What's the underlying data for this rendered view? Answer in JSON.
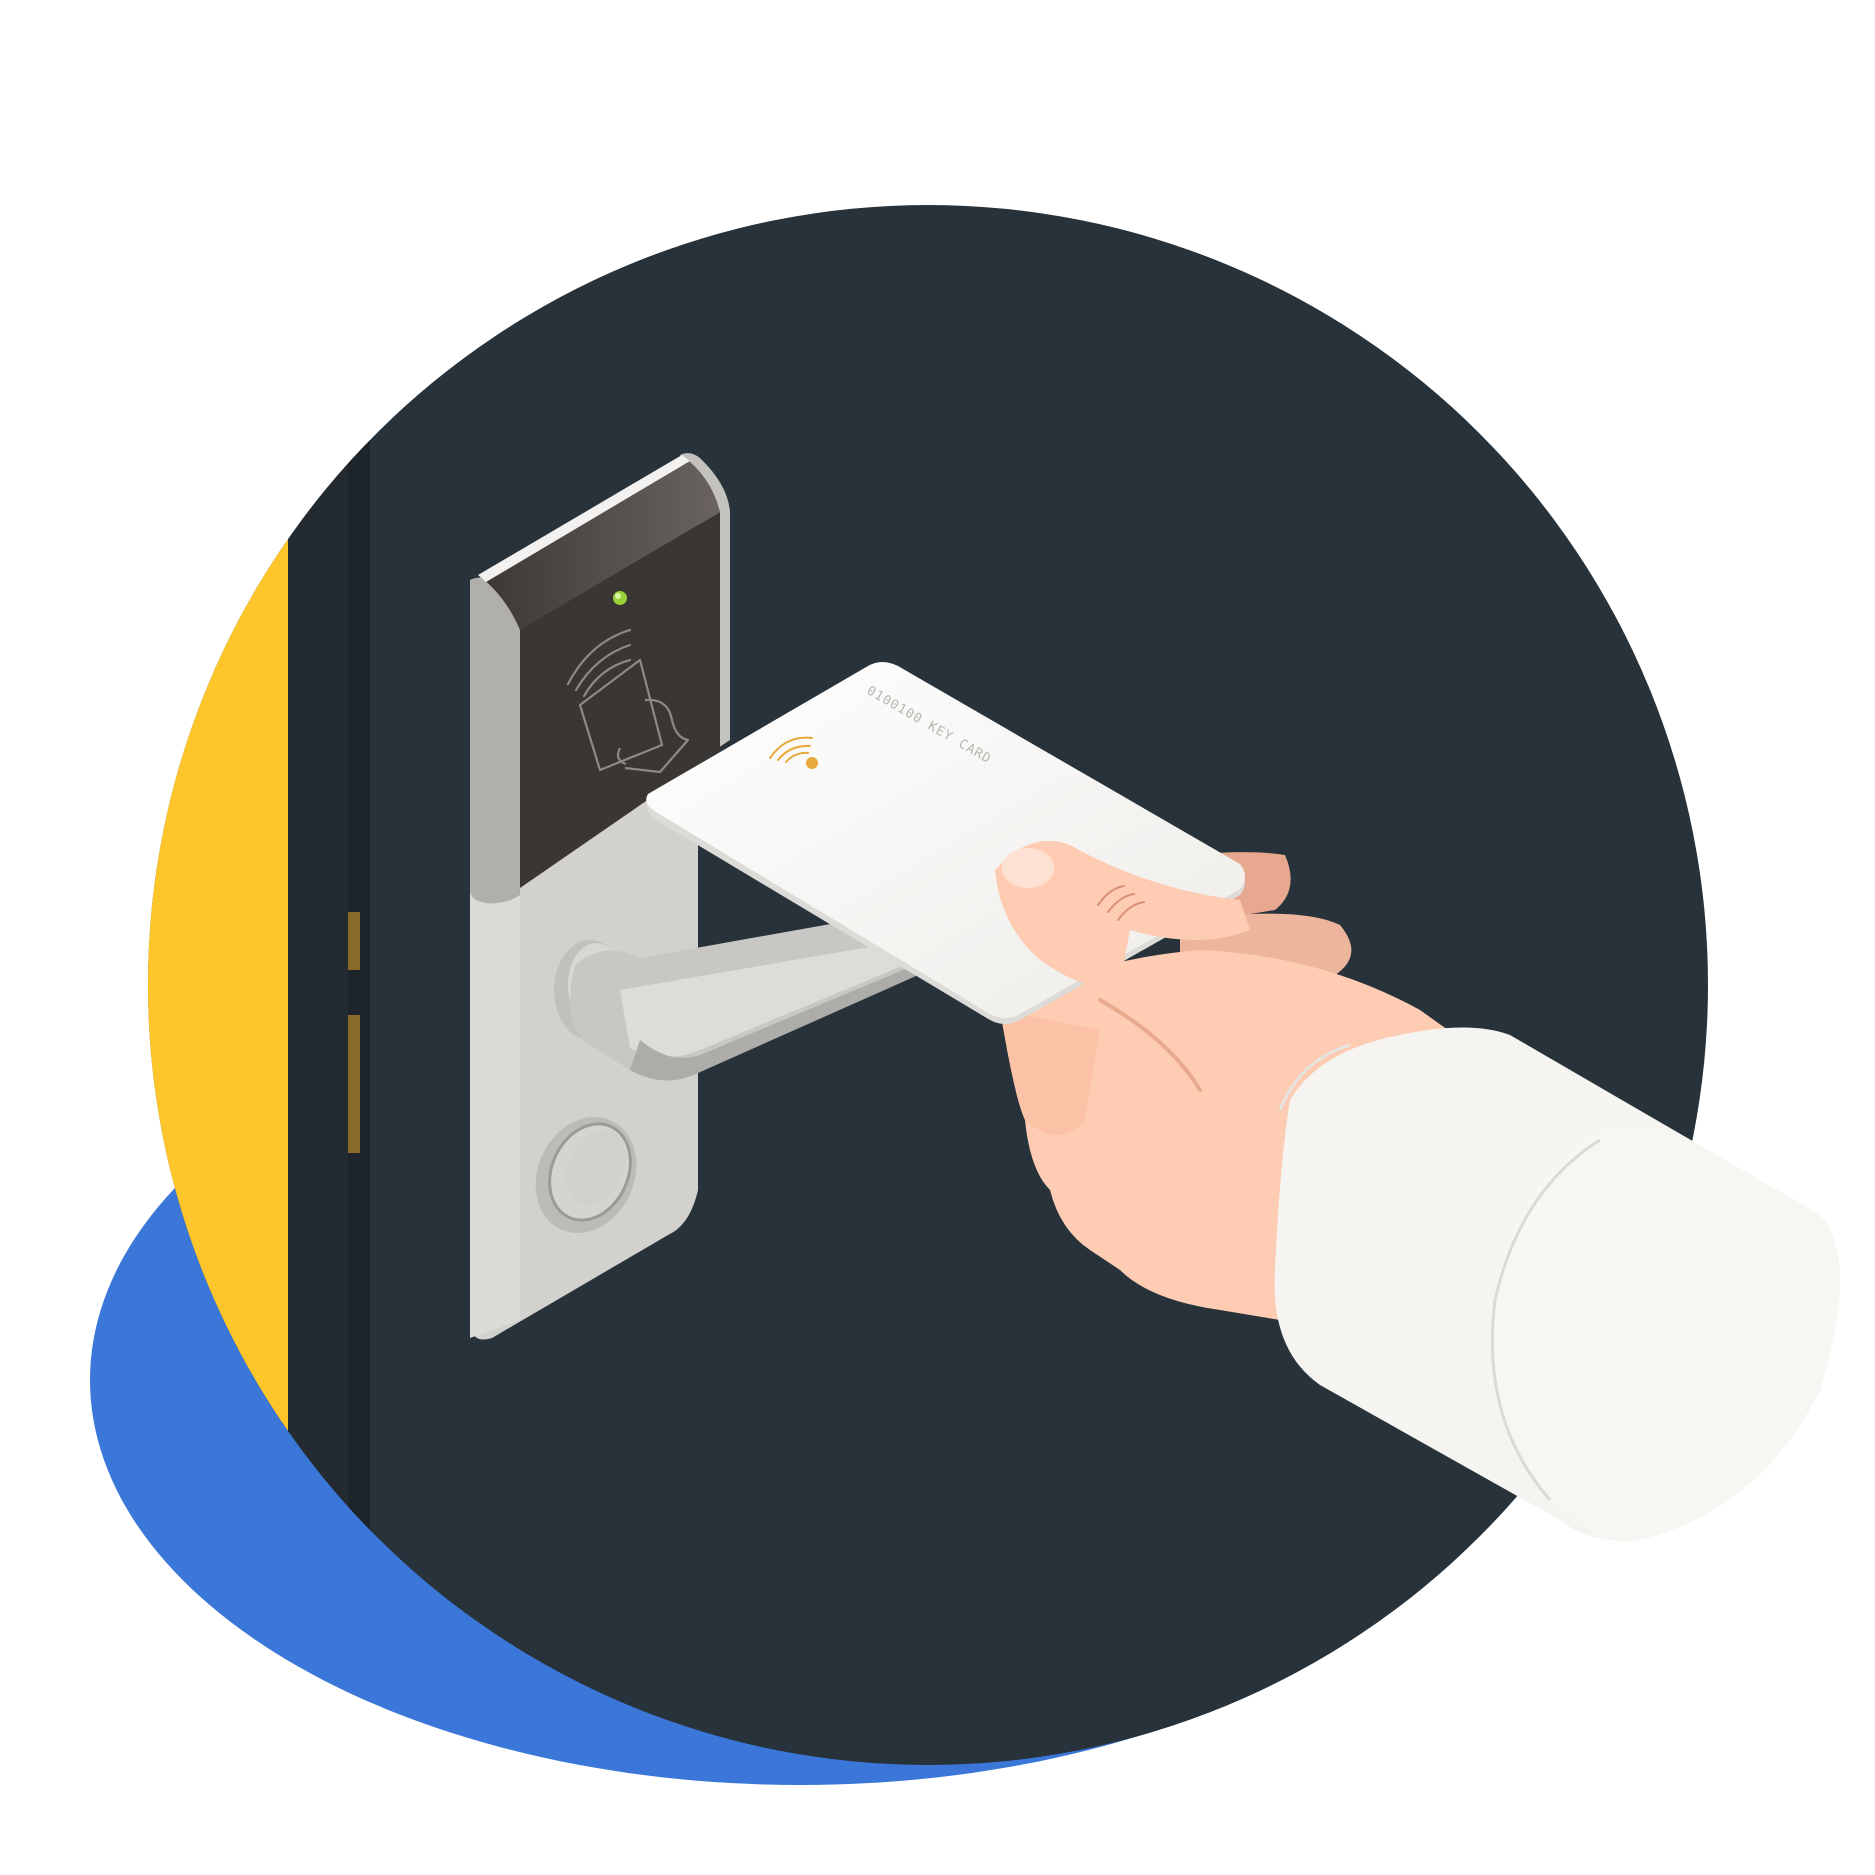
{
  "illustration": {
    "card_label": "0100100 KEY CARD",
    "colors": {
      "background": "#FFFFFF",
      "circle": "#28323A",
      "blob": "#3B77D8",
      "door_edge": "#FEC62A",
      "lock_plate": "#D3D1CE",
      "reader_panel": "#3A3634",
      "status_light": "#9BD03A",
      "card": "#F6F5F2",
      "rfid_mark": "#E8A93C",
      "skin": "#FDCCB2",
      "sleeve": "#F5F4F0"
    },
    "icons": [
      "rfid-wave-icon",
      "tap-card-icon",
      "status-light",
      "keyhole"
    ]
  }
}
